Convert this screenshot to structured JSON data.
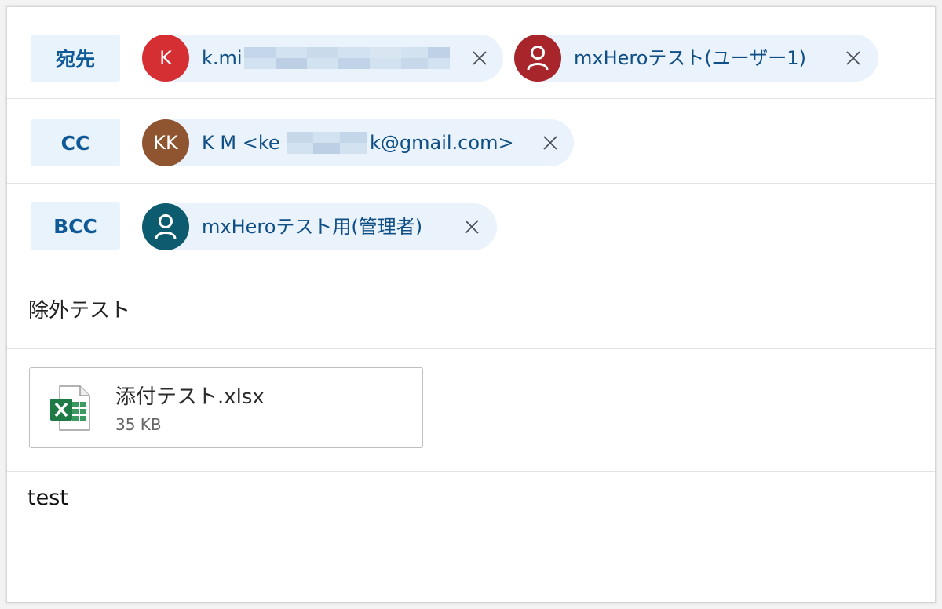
{
  "fields": {
    "to_label": "宛先",
    "cc_label": "CC",
    "bcc_label": "BCC"
  },
  "recipients": {
    "to": [
      {
        "initials": "K",
        "text": "k.mi",
        "avatar_color": "#d52f34"
      },
      {
        "initials": "",
        "text": "mxHeroテスト(ユーザー1)",
        "avatar_color": "#a7252b"
      }
    ],
    "cc": [
      {
        "initials": "KK",
        "text_prefix": "K M <ke",
        "text_suffix": "k@gmail.com>",
        "avatar_color": "#8f5430"
      }
    ],
    "bcc": [
      {
        "initials": "",
        "text": "mxHeroテスト用(管理者)",
        "avatar_color": "#0d5b6e"
      }
    ]
  },
  "icons": {
    "remove": "close-icon",
    "person": "person-icon",
    "excel": "excel-file-icon"
  },
  "subject": "除外テスト",
  "attachment": {
    "name": "添付テスト.xlsx",
    "size": "35 KB"
  },
  "body": "test",
  "colors": {
    "chip_bg": "#eaf3fb",
    "chip_text": "#0f4f86",
    "field_label": "#0f5a96",
    "excel_green": "#1e7b45"
  }
}
